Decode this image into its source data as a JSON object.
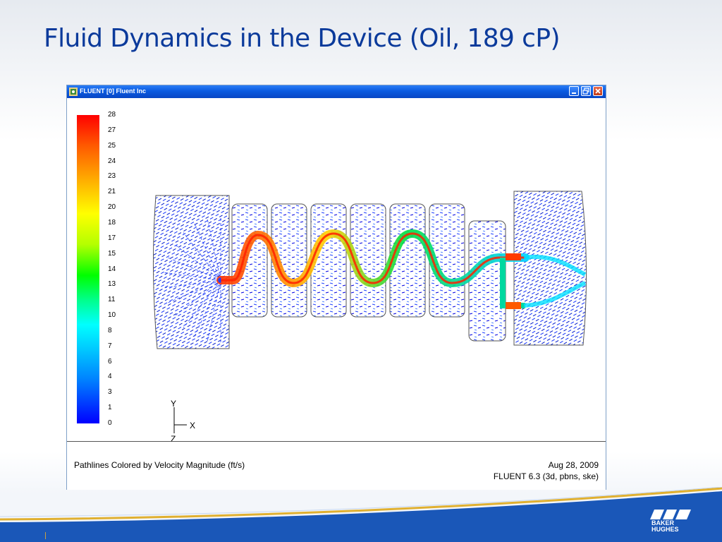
{
  "slide": {
    "title": "Fluid Dynamics in the Device (Oil, 189 cP)",
    "logo_line1": "BAKER",
    "logo_line2": "HUGHES"
  },
  "window": {
    "title": "FLUENT [0] Fluent Inc",
    "buttons": [
      "minimize",
      "restore",
      "close"
    ]
  },
  "colorbar": {
    "ticks": [
      "28",
      "27",
      "25",
      "24",
      "23",
      "21",
      "20",
      "18",
      "17",
      "15",
      "14",
      "13",
      "11",
      "10",
      "8",
      "7",
      "6",
      "4",
      "3",
      "1",
      "0"
    ]
  },
  "axes": {
    "y": "Y",
    "x": "X",
    "z": "Z"
  },
  "info": {
    "left": "Pathlines Colored by Velocity Magnitude (ft/s)",
    "date": "Aug 28, 2009",
    "version": "FLUENT 6.3 (3d, pbns, ske)"
  },
  "colors": {
    "title": "#0b3a9b",
    "titlebar": "#0a5ae0",
    "footer_blue": "#1a57b8",
    "footer_gold": "#e0b030"
  }
}
